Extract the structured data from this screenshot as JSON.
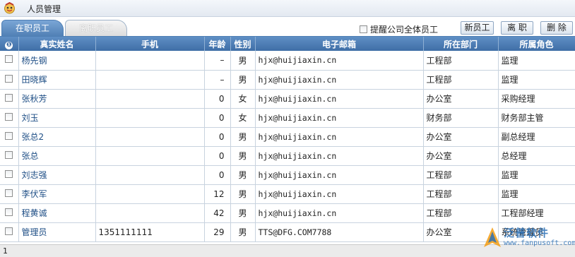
{
  "window": {
    "title": "人员管理"
  },
  "tabs": [
    {
      "label": "在职员工",
      "active": true
    },
    {
      "label": "离职员工",
      "active": false
    }
  ],
  "toolbar": {
    "notify_label": "提醒公司全体员工",
    "new_label": "新员工",
    "leave_label": "离 职",
    "delete_label": "删 除"
  },
  "columns": {
    "info": "❶",
    "name": "真实姓名",
    "phone": "手机",
    "age": "年龄",
    "gender": "性别",
    "email": "电子邮箱",
    "dept": "所在部门",
    "role": "所属角色"
  },
  "rows": [
    {
      "name": "杨先钢",
      "phone": "",
      "age": "–",
      "gender": "男",
      "email": "hjx@huijiaxin.cn",
      "dept": "工程部",
      "role": "监理"
    },
    {
      "name": "田晓辉",
      "phone": "",
      "age": "–",
      "gender": "男",
      "email": "hjx@huijiaxin.cn",
      "dept": "工程部",
      "role": "监理"
    },
    {
      "name": "张秋芳",
      "phone": "",
      "age": "0",
      "gender": "女",
      "email": "hjx@huijiaxin.cn",
      "dept": "办公室",
      "role": "采购经理"
    },
    {
      "name": "刘玉",
      "phone": "",
      "age": "0",
      "gender": "女",
      "email": "hjx@huijiaxin.cn",
      "dept": "财务部",
      "role": "财务部主管"
    },
    {
      "name": "张总2",
      "phone": "",
      "age": "0",
      "gender": "男",
      "email": "hjx@huijiaxin.cn",
      "dept": "办公室",
      "role": "副总经理"
    },
    {
      "name": "张总",
      "phone": "",
      "age": "0",
      "gender": "男",
      "email": "hjx@huijiaxin.cn",
      "dept": "办公室",
      "role": "总经理"
    },
    {
      "name": "刘志强",
      "phone": "",
      "age": "0",
      "gender": "男",
      "email": "hjx@huijiaxin.cn",
      "dept": "工程部",
      "role": "监理"
    },
    {
      "name": "李伏军",
      "phone": "",
      "age": "12",
      "gender": "男",
      "email": "hjx@huijiaxin.cn",
      "dept": "工程部",
      "role": "监理"
    },
    {
      "name": "程黄诚",
      "phone": "",
      "age": "42",
      "gender": "男",
      "email": "hjx@huijiaxin.cn",
      "dept": "工程部",
      "role": "工程部经理"
    },
    {
      "name": "管理员",
      "phone": "1351111111",
      "age": "29",
      "gender": "男",
      "email": "TTS@DFG.COM7788",
      "dept": "办公室",
      "role": "系统管理员"
    }
  ],
  "footer": {
    "page": "1"
  },
  "watermark": {
    "brand": "泛普软件",
    "url": "www.fanpusoft.com"
  },
  "colors": {
    "header": "#4f7fb4",
    "link": "#1f4f86"
  },
  "icons": {
    "logo": "app-logo-icon",
    "info": "info-icon"
  }
}
